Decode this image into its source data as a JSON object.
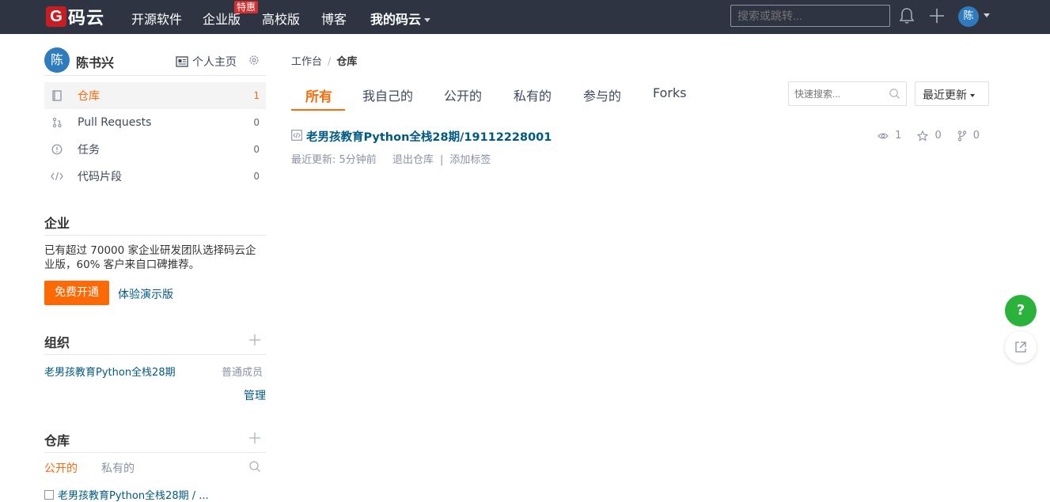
{
  "topnav": {
    "logo_letter": "G",
    "logo_text": "码云",
    "items": [
      "开源软件",
      "企业版",
      "高校版",
      "博客",
      "我的码云"
    ],
    "hot_badge": "特惠",
    "search_placeholder": "搜索或跳转...",
    "avatar": "陈"
  },
  "user": {
    "avatar": "陈",
    "name": "陈书兴",
    "home_link": "个人主页"
  },
  "side_menu": [
    {
      "label": "仓库",
      "count": "1",
      "icon": "repo-icon"
    },
    {
      "label": "Pull Requests",
      "count": "0",
      "icon": "pull-request-icon"
    },
    {
      "label": "任务",
      "count": "0",
      "icon": "issue-icon"
    },
    {
      "label": "代码片段",
      "count": "0",
      "icon": "code-icon"
    }
  ],
  "enterprise": {
    "title": "企业",
    "desc_line1": "已有超过 70000 家企业研发团队选择码云企",
    "desc_line2": "业版，60% 客户来自口碑推荐。",
    "free_button": "免费开通",
    "demo_link": "体验演示版"
  },
  "orgs": {
    "title": "组织",
    "items": [
      {
        "name": "老男孩教育Python全栈28期",
        "role": "普通成员"
      }
    ],
    "manage": "管理"
  },
  "side_repos": {
    "title": "仓库",
    "tabs": [
      "公开的",
      "私有的"
    ],
    "first_item": "老男孩教育Python全栈28期 / ..."
  },
  "breadcrumb": {
    "root": "工作台",
    "separator": "/",
    "current": "仓库"
  },
  "tabs": [
    "所有",
    "我自己的",
    "公开的",
    "私有的",
    "参与的",
    "Forks"
  ],
  "quick_search_placeholder": "快速搜索...",
  "sort_label": "最近更新",
  "repos": [
    {
      "title": "老男孩教育Python全栈28期/19112228001",
      "updated": "最近更新: 5分钟前",
      "action_exit": "退出仓库",
      "meta_pipe": "|",
      "action_tag": "添加标签",
      "watch": "1",
      "stars": "0",
      "forks": "0"
    }
  ],
  "float": {
    "help": "?"
  },
  "colors": {
    "accent": "#f46c0b",
    "topbar": "#2e3442",
    "link": "#005980",
    "help": "#2bb23b"
  }
}
